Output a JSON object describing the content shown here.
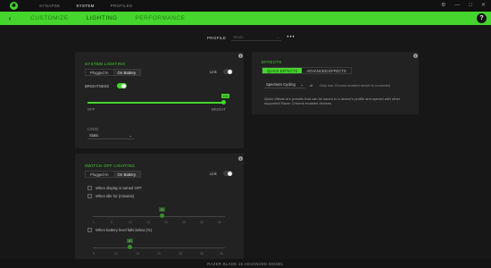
{
  "app": {
    "top_tabs": [
      "SYNAPSE",
      "SYSTEM",
      "PROFILES"
    ],
    "active_top_tab": 1,
    "window_controls": [
      "⚙",
      "—",
      "□",
      "✕"
    ],
    "sub_tabs": [
      "CUSTOMIZE",
      "LIGHTING",
      "PERFORMANCE"
    ],
    "active_sub_tab": 1,
    "help_label": "?"
  },
  "profile": {
    "label": "PROFILE",
    "value": "Blade",
    "more": "•••"
  },
  "system_lighting": {
    "title": "SYSTEM LIGHTING",
    "tabs": [
      "Plugged In",
      "On Battery"
    ],
    "active_tab": 1,
    "link_label": "Link",
    "brightness_label": "BRIGHTNESS",
    "brightness_value": "100",
    "brightness_percent": 100,
    "min_label": "OFF",
    "max_label": "BRIGHT",
    "logo_label": "LOGO",
    "logo_value": "Static"
  },
  "switch_off": {
    "title": "SWITCH OFF LIGHTING",
    "tabs": [
      "Plugged In",
      "On Battery"
    ],
    "active_tab": 1,
    "link_label": "Link",
    "option1": "When display is turned OFF",
    "option2": "When idle for (minutes)",
    "idle_value": "15",
    "idle_ticks": [
      "1",
      "5",
      "10",
      "15",
      "20",
      "25",
      "30",
      "45"
    ],
    "option3": "When battery level falls below (%)",
    "battery_value": "10",
    "battery_ticks": [
      "5",
      "10",
      "15",
      "20",
      "25",
      "30",
      "35"
    ]
  },
  "effects": {
    "title": "EFFECTS",
    "tabs": [
      "QUICK EFFECTS",
      "ADVANCED EFFECTS"
    ],
    "active_tab": 0,
    "effect_value": "Spectrum Cycling",
    "chroma_note": "Only rear Chroma enabled device is connected",
    "description": "Quick effects are presets that can be saved to a device's profile and synced with other supported Razer Chroma enabled devices."
  },
  "footer": {
    "device": "RAZER BLADE 15 ADVANCED MODEL"
  }
}
